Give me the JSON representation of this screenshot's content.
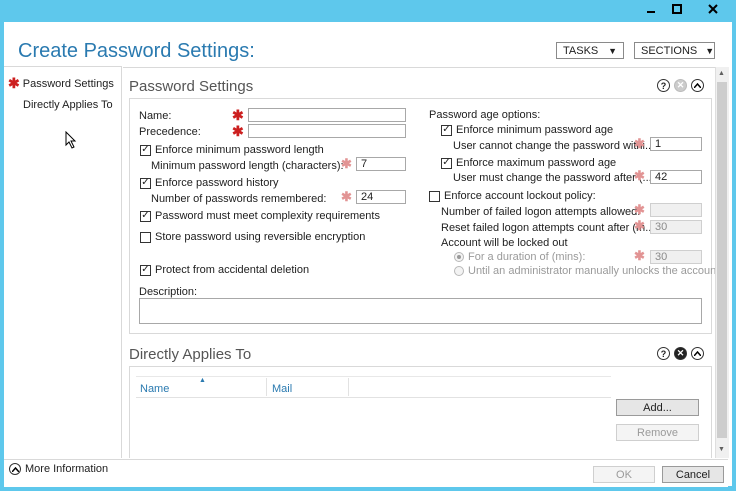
{
  "window": {
    "title": "Create Password Settings:"
  },
  "header": {
    "tasks_label": "TASKS",
    "sections_label": "SECTIONS"
  },
  "nav": {
    "items": [
      "Password Settings",
      "Directly Applies To"
    ]
  },
  "password_settings": {
    "title": "Password Settings",
    "name_label": "Name:",
    "name_value": "",
    "precedence_label": "Precedence:",
    "precedence_value": "",
    "enforce_min_length_label": "Enforce minimum password length",
    "min_length_label": "Minimum password length (characters):",
    "min_length_value": "7",
    "enforce_history_label": "Enforce password history",
    "history_label": "Number of passwords remembered:",
    "history_value": "24",
    "complexity_label": "Password must meet complexity requirements",
    "reversible_label": "Store password using reversible encryption",
    "protect_label": "Protect from accidental deletion",
    "description_label": "Description:",
    "description_value": "",
    "age_options_label": "Password age options:",
    "enforce_min_age_label": "Enforce minimum password age",
    "min_age_label": "User cannot change the password withi...",
    "min_age_value": "1",
    "enforce_max_age_label": "Enforce maximum password age",
    "max_age_label": "User must change the password after (...",
    "max_age_value": "42",
    "lockout_label": "Enforce account lockout policy:",
    "failed_attempts_label": "Number of failed logon attempts allowed:",
    "failed_attempts_value": "",
    "reset_count_label": "Reset failed logon attempts count after (m...",
    "reset_count_value": "30",
    "locked_out_label": "Account will be locked out",
    "duration_label": "For a duration of (mins):",
    "duration_value": "30",
    "admin_unlock_label": "Until an administrator manually unlocks the account",
    "checks": {
      "enforce_min_length": true,
      "enforce_history": true,
      "complexity": true,
      "reversible": false,
      "protect": true,
      "enforce_min_age": true,
      "enforce_max_age": true,
      "lockout": false
    }
  },
  "applies_to": {
    "title": "Directly Applies To",
    "columns": [
      "Name",
      "Mail"
    ],
    "add_label": "Add...",
    "remove_label": "Remove"
  },
  "footer": {
    "more_info_label": "More Information",
    "ok_label": "OK",
    "cancel_label": "Cancel"
  },
  "icons": {
    "required": "asterisk-icon",
    "help": "question-icon",
    "close": "x-circle-icon",
    "collapse": "chevron-up-icon",
    "expand": "chevron-up-circle-icon",
    "cursor": "mouse-pointer-icon"
  },
  "colors": {
    "title": "#2a7ab0",
    "required": "#cc1f1f",
    "background": "#5ec8ec"
  }
}
